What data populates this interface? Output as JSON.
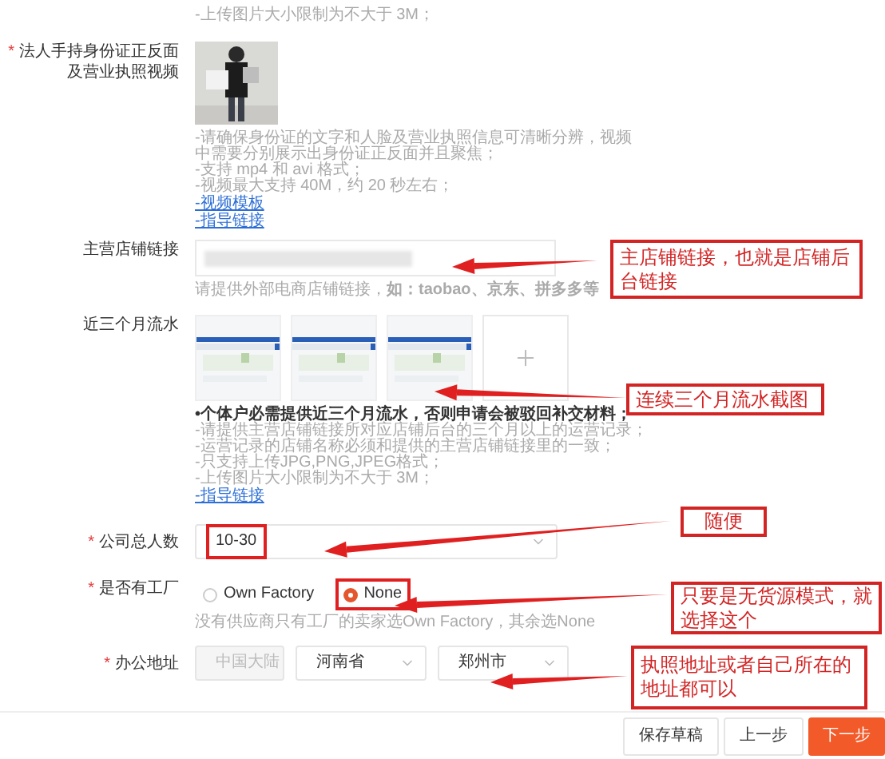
{
  "required_mark": "*",
  "upload_note": "-上传图片大小限制为不大于 3M；",
  "id_video": {
    "label_lines": [
      "法人手持身份证正反面",
      "及营业执照视频"
    ],
    "required": true,
    "image": {
      "kind": "picture"
    },
    "notes": [
      "-请确保身份证的文字和人脸及营业执照信息可清晰分辨，视频中需要分别展示出身份证正反面并且聚焦；",
      "-支持 mp4 和 avi 格式；",
      "-视频最大支持 40M，约 20 秒左右；"
    ],
    "links": [
      "-视频模板",
      "-指导链接"
    ]
  },
  "store_link": {
    "label": "主营店铺链接",
    "hint": "请提供外部电商店铺链接，**如：taobao、京东、拼多多等**"
  },
  "statements": {
    "label": "近三个月流水",
    "images": [
      {
        "kind": "picture"
      },
      {
        "kind": "picture"
      },
      {
        "kind": "picture"
      }
    ],
    "notes": [
      {
        "text": "•个体户必需提供近三个月流水，否则申请会被驳回补交材料；",
        "kind": "bold"
      },
      {
        "text": "-请提供主营店铺链接所对应店铺后台的三个月以上的运营记录；",
        "kind": "plain"
      },
      {
        "text": "-运营记录的店铺名称必须和提供的主营店铺链接里的一致；",
        "kind": "plain"
      },
      {
        "text": "-只支持上传JPG,PNG,JPEG格式；",
        "kind": "plain"
      },
      {
        "text": "-上传图片大小限制为不大于 3M；",
        "kind": "plain"
      }
    ],
    "link": "-指导链接"
  },
  "headcount": {
    "label": "公司总人数",
    "required": true,
    "value": "10-30",
    "highlighted": true
  },
  "factory": {
    "label": "是否有工厂",
    "required": true,
    "options": [
      {
        "label": "Own Factory",
        "selected": false,
        "highlighted": false
      },
      {
        "label": "None",
        "selected": true,
        "highlighted": true
      }
    ],
    "hint": "没有供应商只有工厂的卖家选Own Factory，其余选None"
  },
  "address": {
    "label": "办公地址",
    "required": true,
    "fields": [
      {
        "value": "中国大陆",
        "disabled": true
      },
      {
        "value": "河南省",
        "disabled": false
      },
      {
        "value": "郑州市",
        "disabled": false
      }
    ]
  },
  "buttons": [
    {
      "label": "保存草稿",
      "kind": "default"
    },
    {
      "label": "上一步",
      "kind": "default"
    },
    {
      "label": "下一步",
      "kind": "primary"
    }
  ],
  "annotations": [
    {
      "text": "主店铺链接，也就是店铺后台链接"
    },
    {
      "text": "连续三个月流水截图"
    },
    {
      "text": "随便"
    },
    {
      "text": "只要是无货源模式，就选择这个"
    },
    {
      "text": "执照地址或者自己所在的地址都可以"
    }
  ]
}
